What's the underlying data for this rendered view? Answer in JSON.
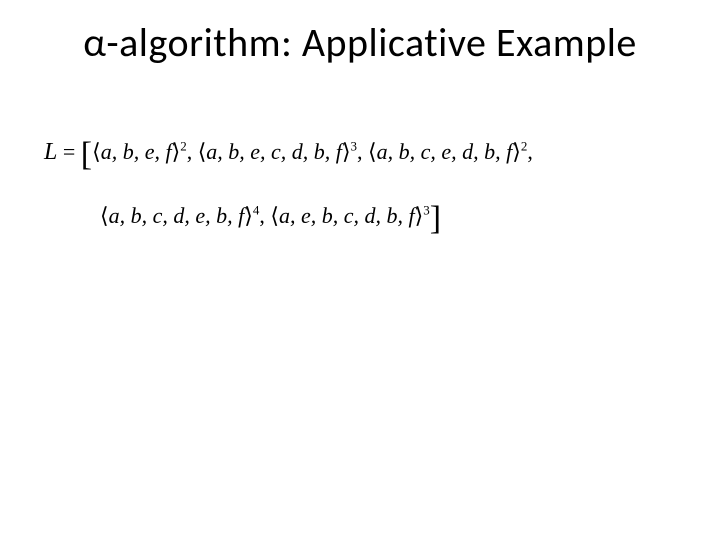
{
  "title": "α-algorithm: Applicative Example",
  "eq": {
    "L": "L",
    "eq_sign": " = ",
    "lbr": "[",
    "rbr": "]",
    "comma": ", ",
    "terms": [
      {
        "open": "⟨",
        "seq": "a, b, e, f",
        "close": "⟩",
        "pow": "2"
      },
      {
        "open": "⟨",
        "seq": "a, b, e, c, d, b, f",
        "close": "⟩",
        "pow": "3"
      },
      {
        "open": "⟨",
        "seq": "a, b, c, e, d, b, f",
        "close": "⟩",
        "pow": "2"
      },
      {
        "open": "⟨",
        "seq": "a, b, c, d, e, b, f",
        "close": "⟩",
        "pow": "4"
      },
      {
        "open": "⟨",
        "seq": "a, e, b, c, d, b, f",
        "close": "⟩",
        "pow": "3"
      }
    ]
  }
}
